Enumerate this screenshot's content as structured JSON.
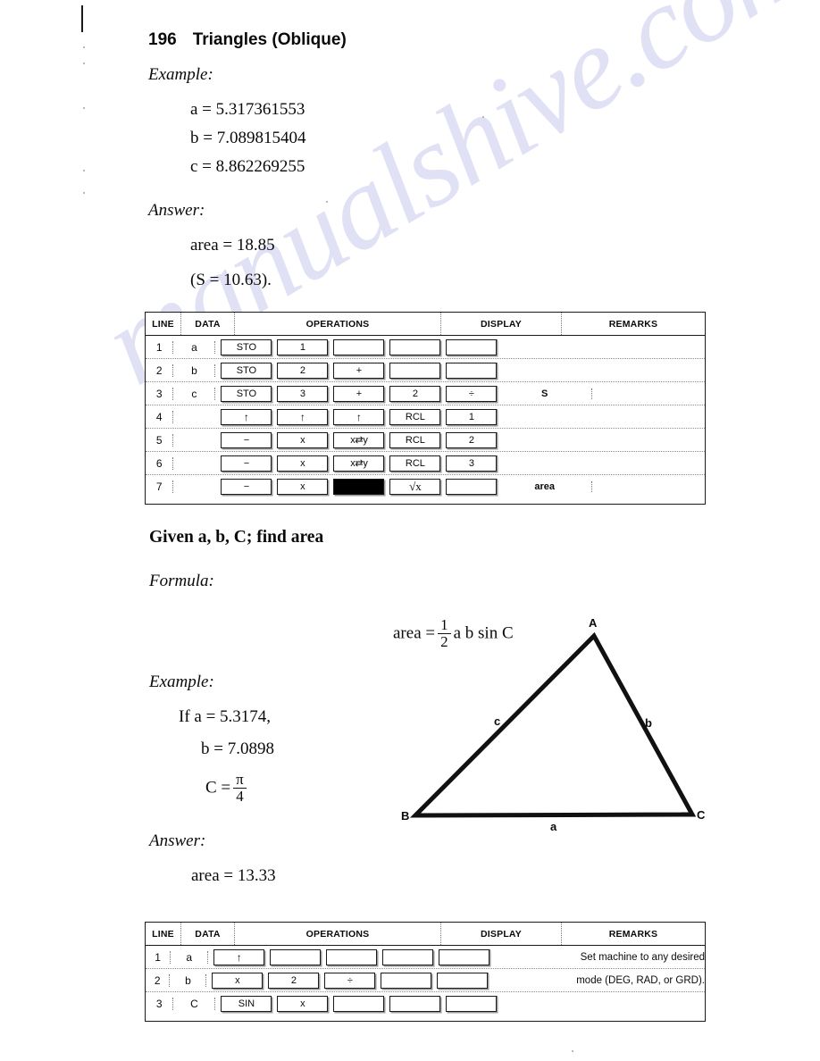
{
  "header": {
    "page_number": "196",
    "title": "Triangles (Oblique)"
  },
  "watermark": {
    "text": "manualshive.com"
  },
  "section_one": {
    "example_label": "Example:",
    "given": [
      "a = 5.317361553",
      "b = 7.089815404",
      "c = 8.862269255"
    ],
    "answer_label": "Answer:",
    "answer_lines": [
      "area = 18.85",
      "(S = 10.63)."
    ]
  },
  "table_one": {
    "columns": [
      "LINE",
      "DATA",
      "OPERATIONS",
      "DISPLAY",
      "REMARKS"
    ],
    "rows": [
      {
        "line": "1",
        "data": "a",
        "keys": [
          "STO",
          "1",
          "",
          "",
          ""
        ],
        "display": "",
        "remarks": ""
      },
      {
        "line": "2",
        "data": "b",
        "keys": [
          "STO",
          "2",
          "+",
          "",
          ""
        ],
        "display": "",
        "remarks": ""
      },
      {
        "line": "3",
        "data": "c",
        "keys": [
          "STO",
          "3",
          "+",
          "2",
          "÷"
        ],
        "display": "S",
        "remarks": ""
      },
      {
        "line": "4",
        "data": "",
        "keys": [
          "↑",
          "↑",
          "↑",
          "RCL",
          "1"
        ],
        "display": "",
        "remarks": ""
      },
      {
        "line": "5",
        "data": "",
        "keys": [
          "−",
          "x",
          "x⇄y",
          "RCL",
          "2"
        ],
        "display": "",
        "remarks": ""
      },
      {
        "line": "6",
        "data": "",
        "keys": [
          "−",
          "x",
          "x⇄y",
          "RCL",
          "3"
        ],
        "display": "",
        "remarks": ""
      },
      {
        "line": "7",
        "data": "",
        "keys": [
          "−",
          "x",
          "FILLED",
          "√x",
          ""
        ],
        "display": "area",
        "remarks": ""
      }
    ]
  },
  "section_two": {
    "heading": "Given a, b, C; find area",
    "formula_label": "Formula:",
    "formula": {
      "lead": "area =",
      "fraction_numerator": "1",
      "fraction_denominator": "2",
      "trail": "a b sin C"
    },
    "example_label": "Example:",
    "given": [
      "If  a = 5.3174,",
      "b = 7.0898"
    ],
    "given_fraction": {
      "lead": "C =",
      "numerator": "π",
      "denominator": "4"
    },
    "answer_label": "Answer:",
    "answer_lines": [
      "area = 13.33"
    ]
  },
  "diagram": {
    "vertex_a": "A",
    "vertex_b": "B",
    "vertex_c": "C",
    "side_a": "a",
    "side_b": "b",
    "side_c": "c"
  },
  "table_two": {
    "columns": [
      "LINE",
      "DATA",
      "OPERATIONS",
      "DISPLAY",
      "REMARKS"
    ],
    "rows": [
      {
        "line": "1",
        "data": "a",
        "keys": [
          "↑",
          "",
          "",
          "",
          ""
        ],
        "display": "",
        "remarks": "Set machine to any desired"
      },
      {
        "line": "2",
        "data": "b",
        "keys": [
          "x",
          "2",
          "÷",
          "",
          ""
        ],
        "display": "",
        "remarks": "mode (DEG, RAD, or GRD)."
      },
      {
        "line": "3",
        "data": "C",
        "keys": [
          "SIN",
          "x",
          "",
          "",
          ""
        ],
        "display": "",
        "remarks": ""
      }
    ]
  }
}
